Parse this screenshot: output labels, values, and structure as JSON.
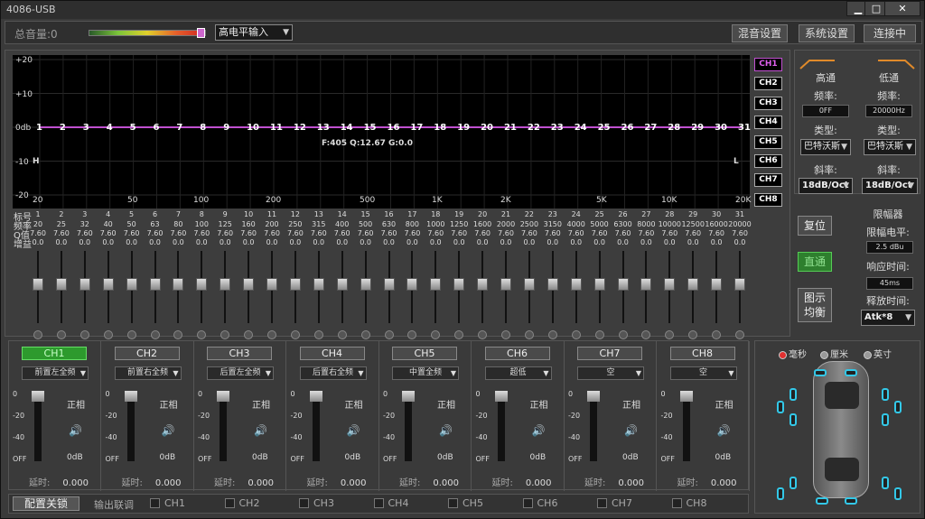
{
  "window": {
    "title": "4086-USB",
    "min": "▁",
    "max": "□",
    "close": "✕"
  },
  "toolbar": {
    "master_volume_label": "总音量:0",
    "input_select": "高电平输入",
    "mix_settings": "混音设置",
    "system_settings": "系统设置",
    "connect_status": "连接中"
  },
  "eq": {
    "y_ticks": [
      "+20",
      "+10",
      "0db",
      "-10",
      "-20"
    ],
    "x_ticks": [
      "20",
      "50",
      "100",
      "200",
      "500",
      "1K",
      "2K",
      "5K",
      "10K",
      "20K"
    ],
    "band_numbers": [
      "1",
      "2",
      "3",
      "4",
      "5",
      "6",
      "7",
      "8",
      "9",
      "10",
      "11",
      "12",
      "13",
      "14",
      "15",
      "16",
      "17",
      "18",
      "19",
      "20",
      "21",
      "22",
      "23",
      "24",
      "25",
      "26",
      "27",
      "28",
      "29",
      "30",
      "31"
    ],
    "readout": "F:405 Q:12.67 G:0.0",
    "left_marker": "H",
    "right_marker": "L",
    "channels": [
      "CH1",
      "CH2",
      "CH3",
      "CH4",
      "CH5",
      "CH6",
      "CH7",
      "CH8"
    ],
    "row_labels": [
      "标号",
      "频率",
      "Q值",
      "增益"
    ],
    "freqs": [
      "20",
      "25",
      "32",
      "40",
      "50",
      "63",
      "80",
      "100",
      "125",
      "160",
      "200",
      "250",
      "315",
      "400",
      "500",
      "630",
      "800",
      "1000",
      "1250",
      "1600",
      "2000",
      "2500",
      "3150",
      "4000",
      "5000",
      "6300",
      "8000",
      "10000",
      "12500",
      "16000",
      "20000"
    ],
    "q": "7.60",
    "gain": "0.0"
  },
  "side": {
    "reset": "复位",
    "bypass": "直通",
    "display_eq_1": "图示",
    "display_eq_2": "均衡"
  },
  "filter": {
    "high_pass": "高通",
    "low_pass": "低通",
    "freq_label": "频率:",
    "type_label": "类型:",
    "slope_label": "斜率:",
    "hp_freq": "0FF",
    "lp_freq": "20000Hz",
    "hp_type": "巴特沃斯",
    "lp_type": "巴特沃斯",
    "hp_slope": "18dB/Oct",
    "lp_slope": "18dB/Oct"
  },
  "limiter": {
    "title": "限幅器",
    "level_label": "限幅电平:",
    "level": "2.5 dBu",
    "attack_label": "响应时间:",
    "attack": "45ms",
    "release_label": "释放时间:",
    "release": "Atk*8"
  },
  "outputs": [
    {
      "name": "CH1",
      "assign": "前置左全频",
      "on": true
    },
    {
      "name": "CH2",
      "assign": "前置右全频",
      "on": false
    },
    {
      "name": "CH3",
      "assign": "后置左全频",
      "on": false
    },
    {
      "name": "CH4",
      "assign": "后置右全频",
      "on": false
    },
    {
      "name": "CH5",
      "assign": "中置全频",
      "on": false
    },
    {
      "name": "CH6",
      "assign": "超低",
      "on": false
    },
    {
      "name": "CH7",
      "assign": "空",
      "on": false
    },
    {
      "name": "CH8",
      "assign": "空",
      "on": false
    }
  ],
  "output_common": {
    "ticks": [
      "0",
      "-20",
      "-40",
      "OFF"
    ],
    "phase": "正相",
    "gain": "0dB",
    "delay_label": "延时:",
    "delay_value": "0.000"
  },
  "bottom": {
    "config_lock": "配置关锁",
    "output_link": "输出联调",
    "chs": [
      "CH1",
      "CH2",
      "CH3",
      "CH4",
      "CH5",
      "CH6",
      "CH7",
      "CH8"
    ]
  },
  "units": {
    "ms": "毫秒",
    "cm": "厘米",
    "inch": "英寸"
  },
  "colors": {
    "eq_line": "#c050d0",
    "accent_green": "#2d9a2d",
    "speaker": "#33c8e8"
  }
}
